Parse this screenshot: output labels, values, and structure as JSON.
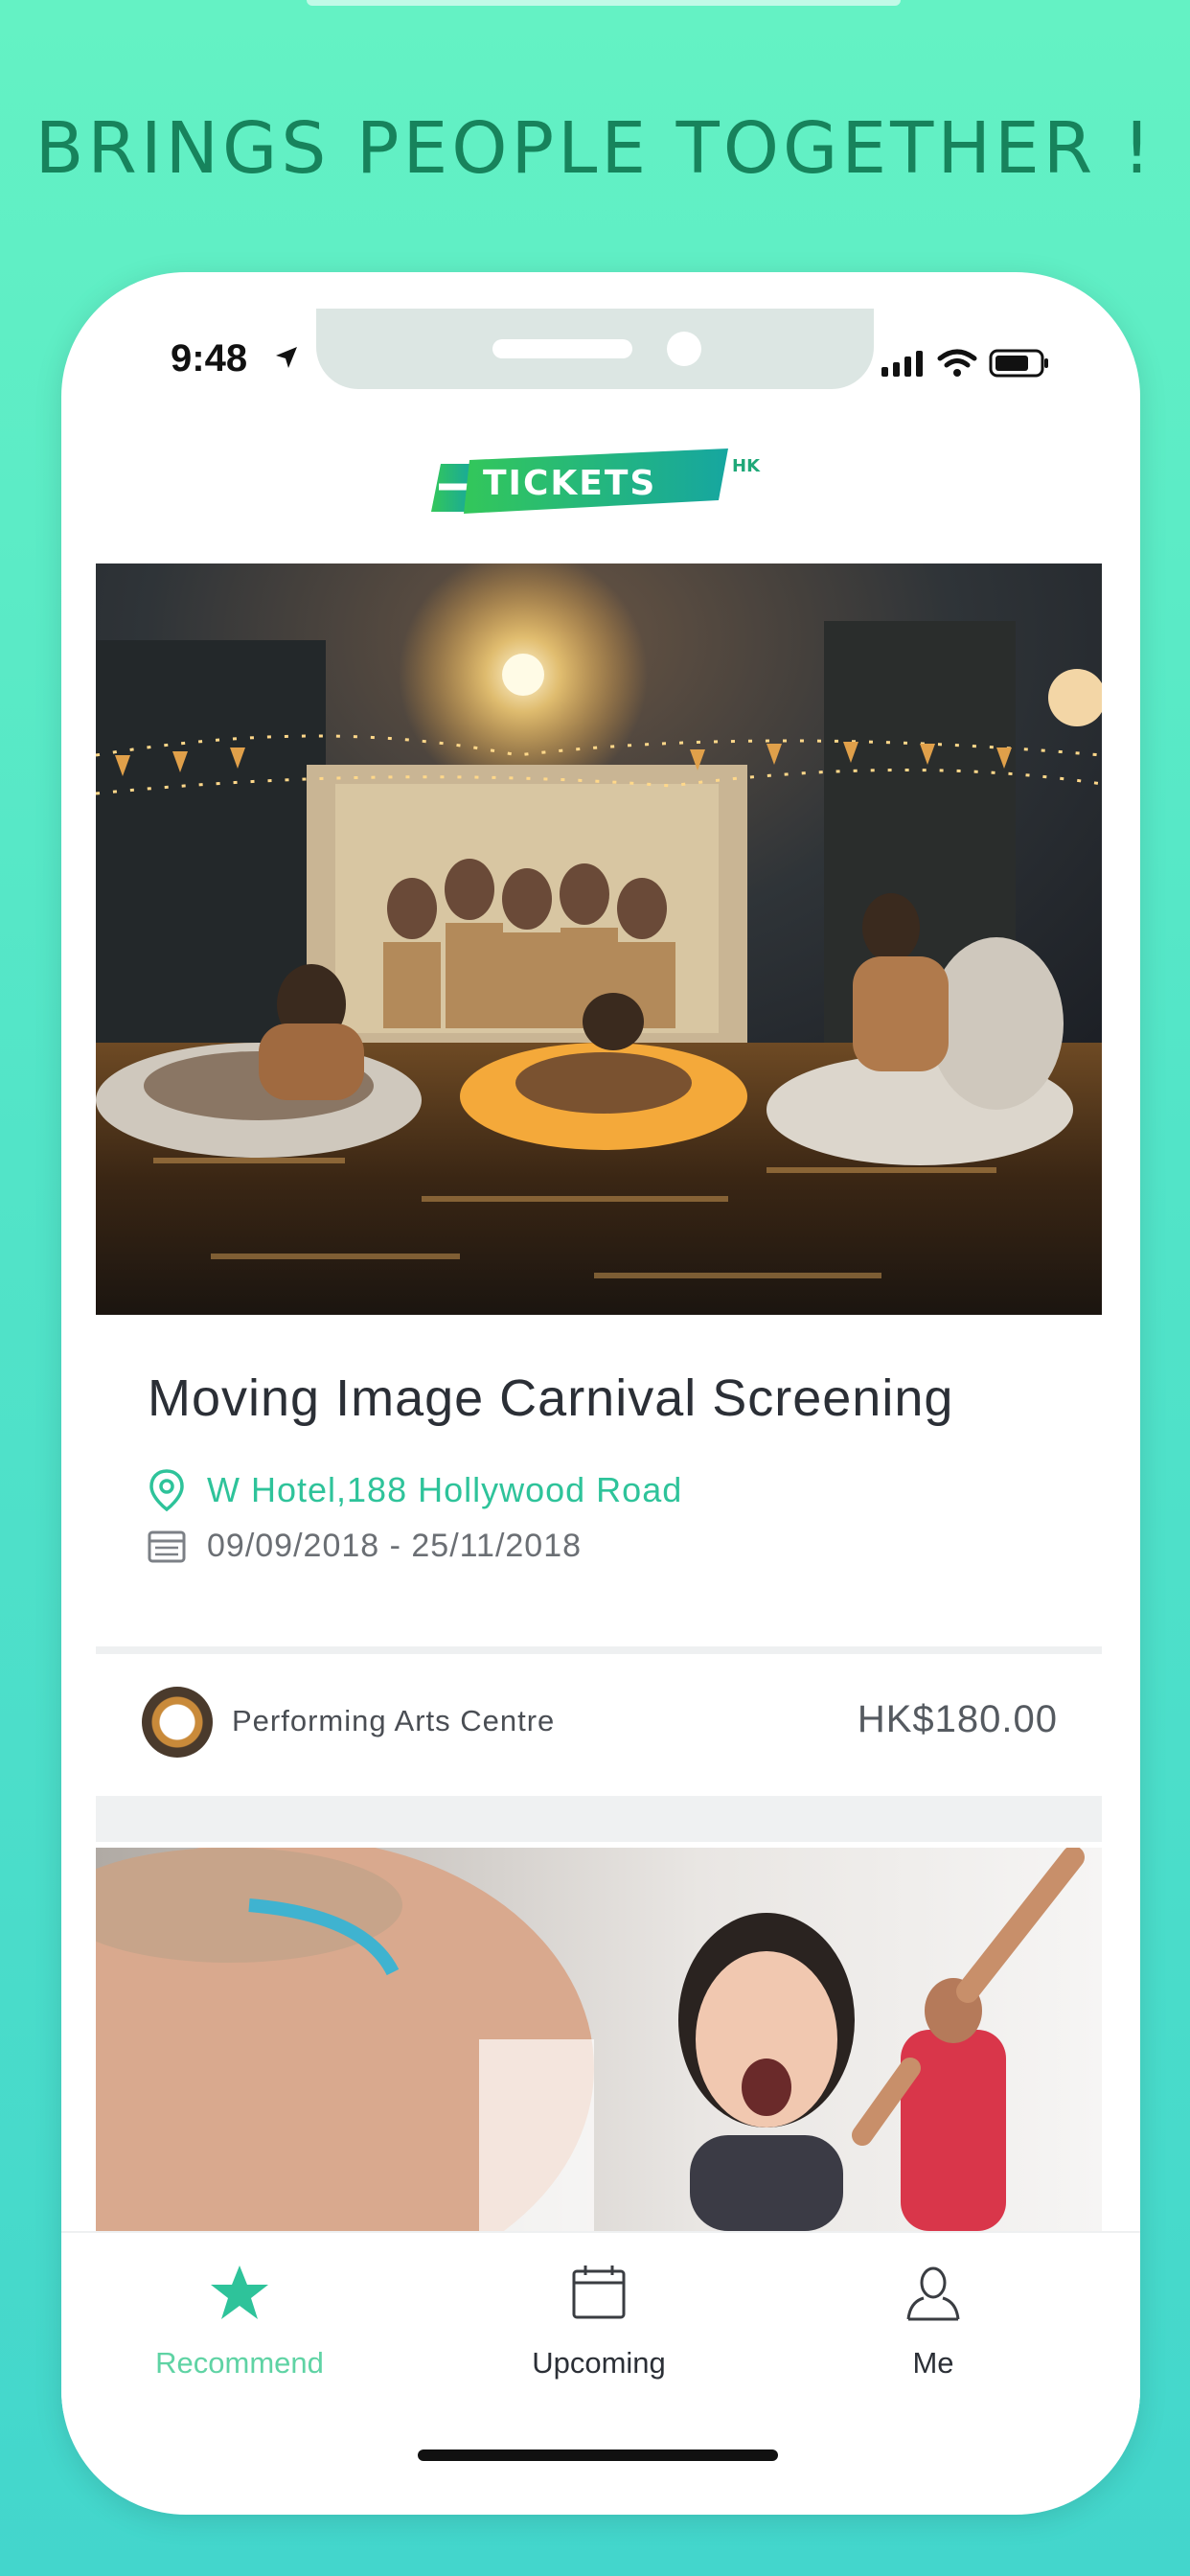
{
  "headline": "BRINGS PEOPLE TOGETHER !",
  "status_bar": {
    "time": "9:48"
  },
  "brand": {
    "logo_main": "TICKETS",
    "logo_suffix": "HK",
    "logo_accent": "#1fb86a"
  },
  "event_card": {
    "title": "Moving Image Carnival Screening",
    "location": "W Hotel,188 Hollywood Road",
    "date_range": "09/09/2018 - 25/11/2018",
    "organizer": "Performing Arts Centre",
    "price": "HK$180.00"
  },
  "tabs": [
    {
      "label": "Recommend",
      "icon": "star-icon",
      "active": true
    },
    {
      "label": "Upcoming",
      "icon": "calendar-icon",
      "active": false
    },
    {
      "label": "Me",
      "icon": "person-icon",
      "active": false
    }
  ],
  "colors": {
    "accent": "#2ec39a",
    "active_tab": "#5fd3a4",
    "headline": "#17835c"
  }
}
